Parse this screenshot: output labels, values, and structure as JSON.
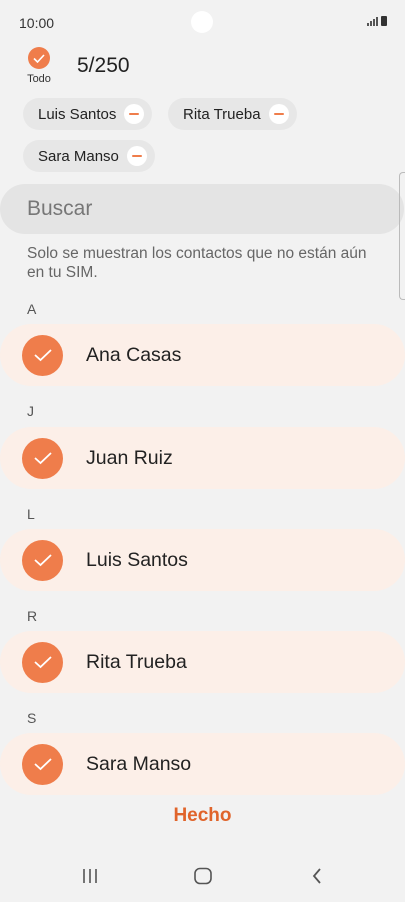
{
  "status_bar": {
    "time": "10:00"
  },
  "header": {
    "select_all_label": "Todo",
    "count": "5/250"
  },
  "chips": [
    {
      "label": "Luis Santos"
    },
    {
      "label": "Rita Trueba"
    },
    {
      "label": "Sara Manso"
    }
  ],
  "search": {
    "placeholder": "Buscar"
  },
  "info": "Solo se muestran los contactos que no están aún en tu SIM.",
  "sections": [
    {
      "letter": "A",
      "contact": "Ana Casas"
    },
    {
      "letter": "J",
      "contact": "Juan Ruiz"
    },
    {
      "letter": "L",
      "contact": "Luis Santos"
    },
    {
      "letter": "R",
      "contact": "Rita Trueba"
    },
    {
      "letter": "S",
      "contact": "Sara Manso"
    }
  ],
  "done_label": "Hecho",
  "colors": {
    "accent": "#ef7d4b",
    "row_bg": "#fcefe8",
    "done_text": "#e0642b"
  }
}
